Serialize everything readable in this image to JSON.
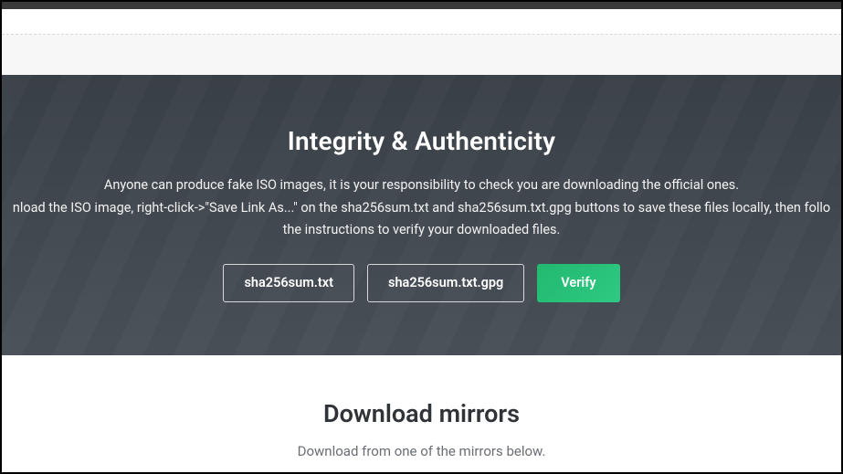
{
  "integrity": {
    "title": "Integrity & Authenticity",
    "line1": "Anyone can produce fake ISO images, it is your responsibility to check you are downloading the official ones.",
    "line2": "nload the ISO image, right-click->\"Save Link As...\" on the sha256sum.txt and sha256sum.txt.gpg buttons to save these files locally, then follo",
    "line3": "the instructions to verify your downloaded files.",
    "buttons": {
      "sha_txt": "sha256sum.txt",
      "sha_gpg": "sha256sum.txt.gpg",
      "verify": "Verify"
    }
  },
  "mirrors": {
    "title": "Download mirrors",
    "subtitle": "Download from one of the mirrors below."
  }
}
